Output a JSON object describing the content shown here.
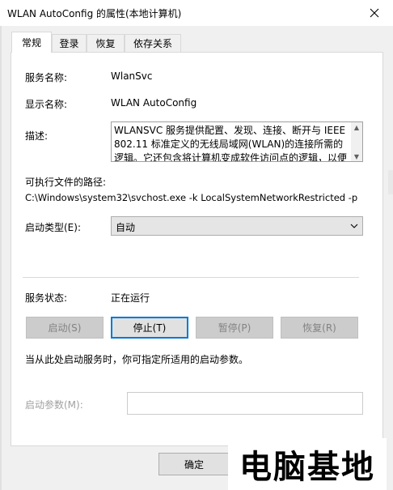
{
  "window": {
    "title": "WLAN AutoConfig 的属性(本地计算机)"
  },
  "tabs": [
    {
      "label": "常规",
      "active": true
    },
    {
      "label": "登录",
      "active": false
    },
    {
      "label": "恢复",
      "active": false
    },
    {
      "label": "依存关系",
      "active": false
    }
  ],
  "general": {
    "service_name_label": "服务名称:",
    "service_name": "WlanSvc",
    "display_name_label": "显示名称:",
    "display_name": "WLAN AutoConfig",
    "description_label": "描述:",
    "description": "WLANSVC 服务提供配置、发现、连接、断开与 IEEE 802.11 标准定义的无线局域网(WLAN)的连接所需的逻辑。它还包含将计算机变成软件访问点的逻辑，以便",
    "exe_path_label": "可执行文件的路径:",
    "exe_path": "C:\\Windows\\system32\\svchost.exe -k LocalSystemNetworkRestricted -p",
    "startup_type_label": "启动类型(E):",
    "startup_type": "自动",
    "status_label": "服务状态:",
    "status": "正在运行"
  },
  "buttons": {
    "start": "启动(S)",
    "stop": "停止(T)",
    "pause": "暂停(P)",
    "resume": "恢复(R)"
  },
  "hint": "当从此处启动服务时，你可指定所适用的启动参数。",
  "start_params_label": "启动参数(M):",
  "start_params_value": "",
  "ok_label": "确定",
  "watermark": "电脑基地"
}
